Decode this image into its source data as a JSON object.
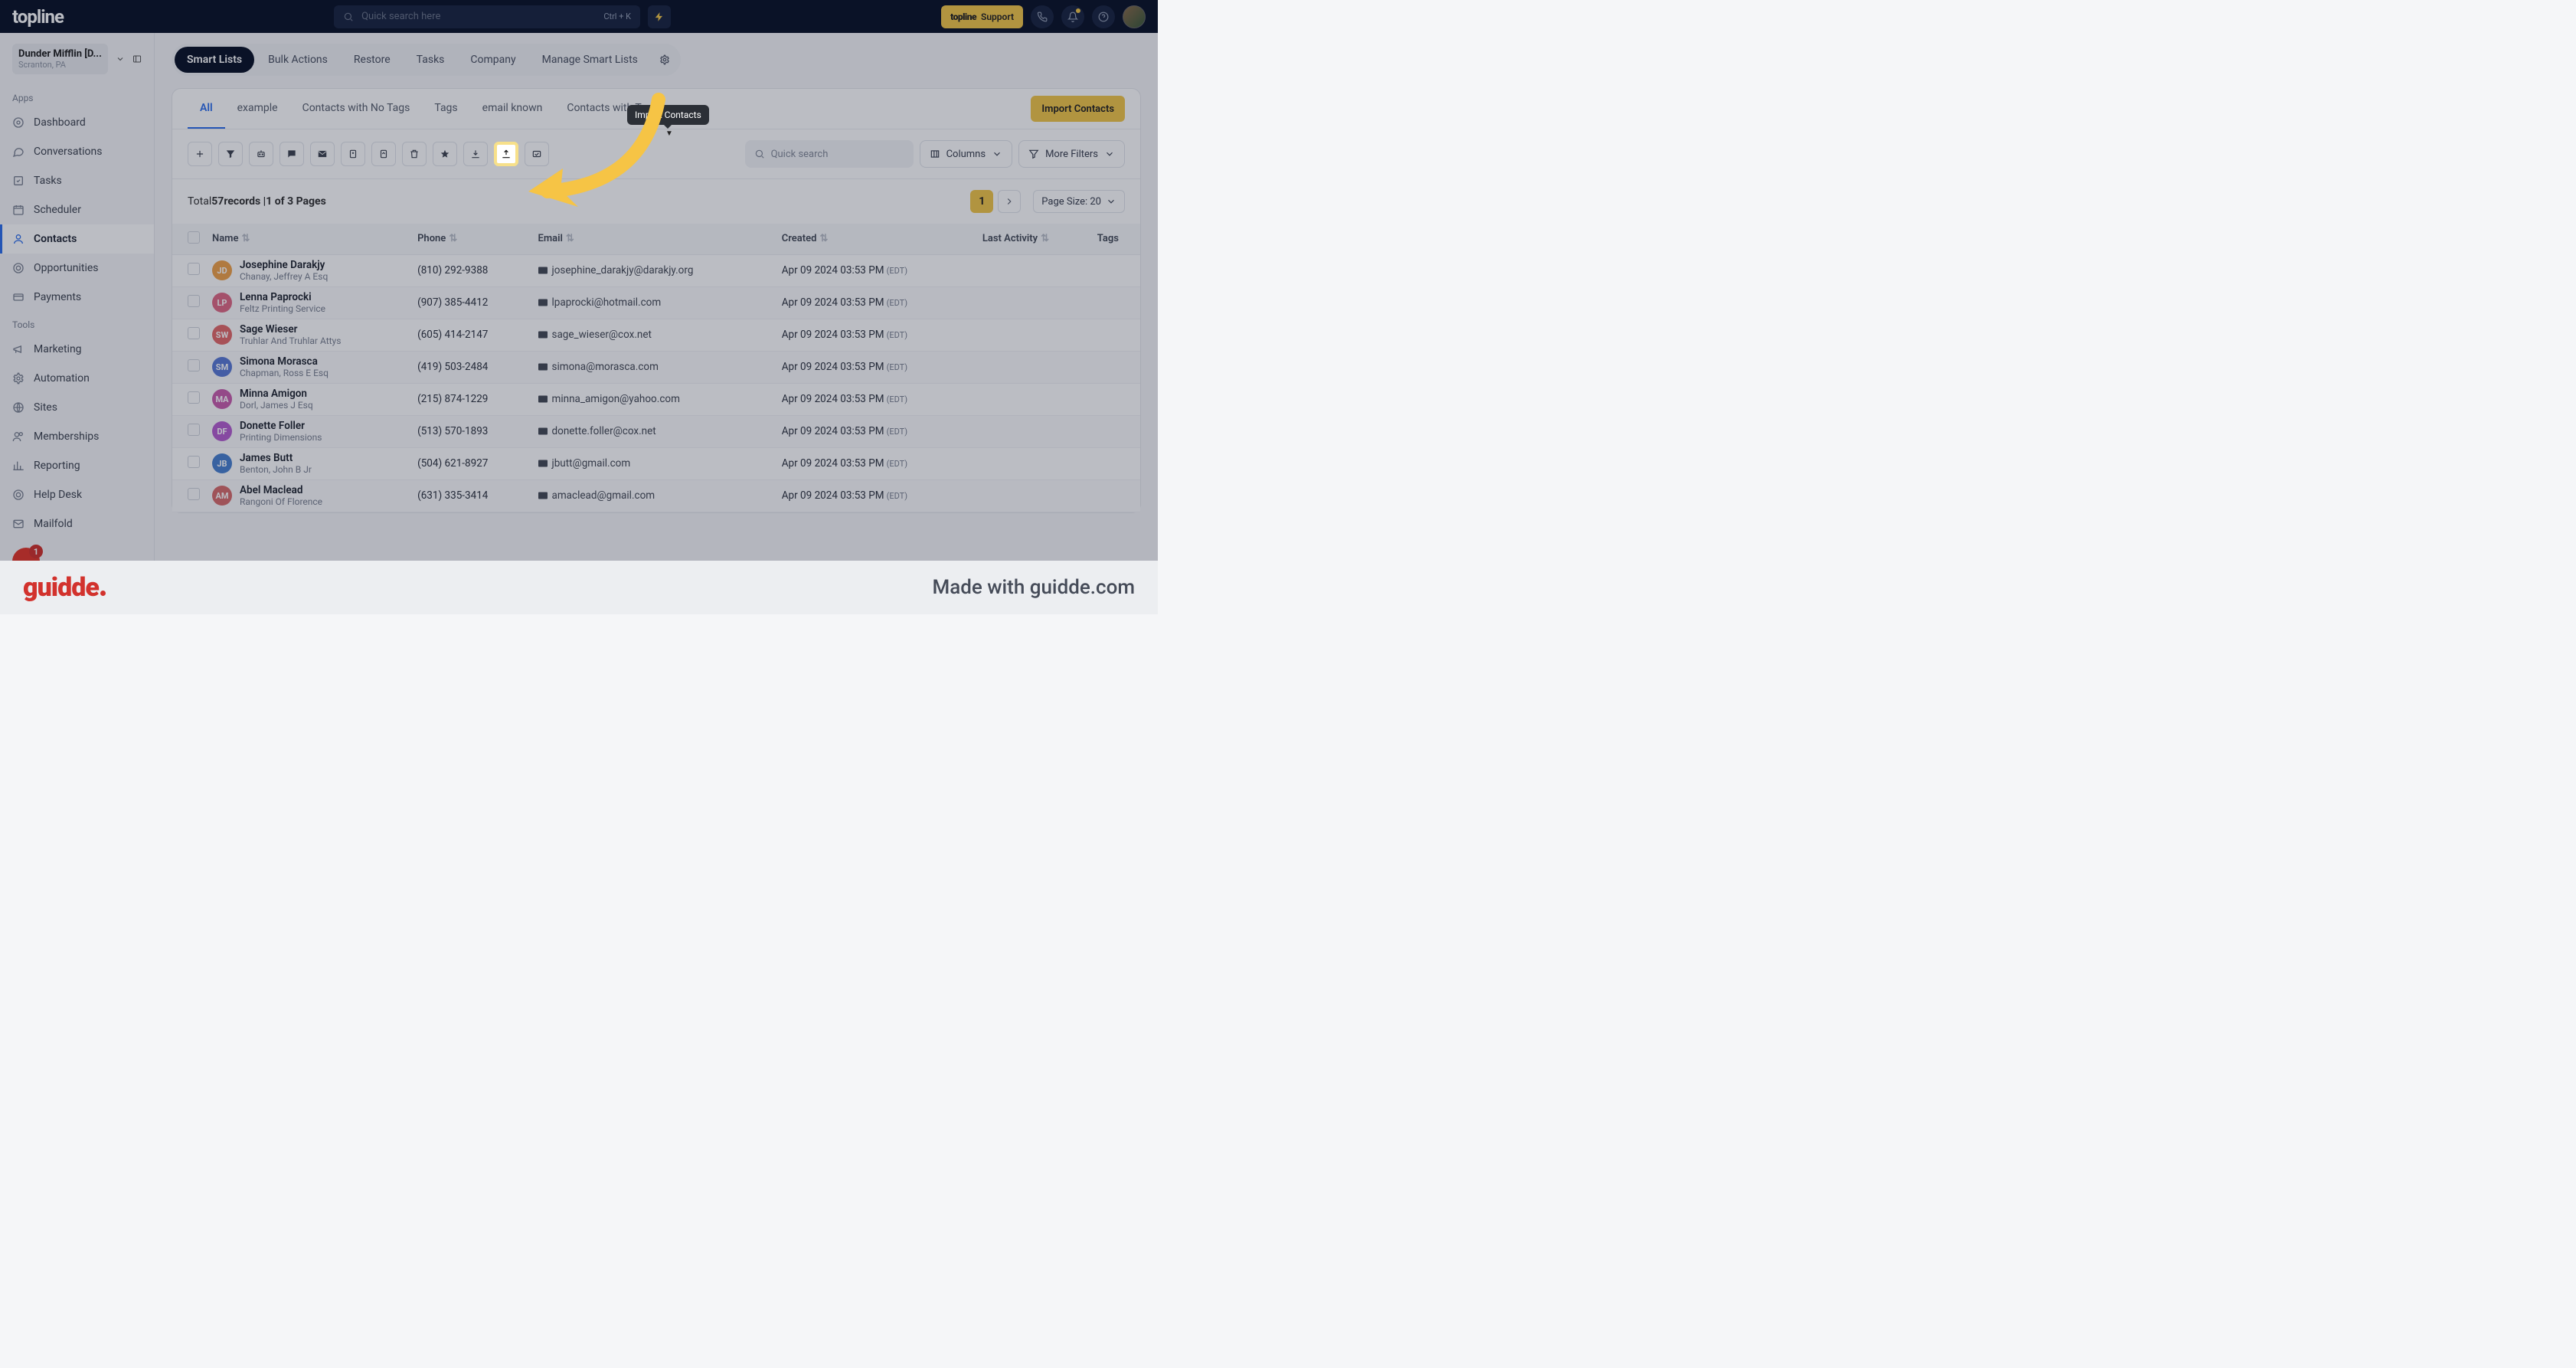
{
  "brand": "topline",
  "search_placeholder": "Quick search here",
  "search_hint": "Ctrl + K",
  "support_label": "Support",
  "support_brand": "topline",
  "tenant": {
    "name": "Dunder Mifflin [D...",
    "sub": "Scranton, PA"
  },
  "side_sections": {
    "apps": "Apps",
    "tools": "Tools"
  },
  "nav_apps": [
    {
      "label": "Dashboard"
    },
    {
      "label": "Conversations"
    },
    {
      "label": "Tasks"
    },
    {
      "label": "Scheduler"
    },
    {
      "label": "Contacts"
    },
    {
      "label": "Opportunities"
    },
    {
      "label": "Payments"
    }
  ],
  "nav_tools": [
    {
      "label": "Marketing"
    },
    {
      "label": "Automation"
    },
    {
      "label": "Sites"
    },
    {
      "label": "Memberships"
    },
    {
      "label": "Reporting"
    },
    {
      "label": "Help Desk"
    },
    {
      "label": "Mailfold"
    }
  ],
  "app_badge": "1",
  "topnav": {
    "items": [
      "Smart Lists",
      "Bulk Actions",
      "Restore",
      "Tasks",
      "Company",
      "Manage Smart Lists"
    ],
    "active": 0
  },
  "tabs": [
    "All",
    "example",
    "Contacts with No Tags",
    "Tags",
    "email known",
    "Contacts with Tags"
  ],
  "tabs_active": 0,
  "import_btn": "Import Contacts",
  "tooltip": "Import Contacts",
  "quick_search": "Quick search",
  "columns_btn": "Columns",
  "filters_btn": "More Filters",
  "records_prefix": "Total ",
  "records_count": "57",
  "records_mid": " records | ",
  "records_pages": "1 of 3 Pages",
  "page_cur": "1",
  "page_size_label": "Page Size: 20",
  "headers": [
    "",
    "Name",
    "Phone",
    "Email",
    "Created",
    "Last Activity",
    "Tags"
  ],
  "rows": [
    {
      "ini": "JD",
      "c": "#f0a24a",
      "name": "Josephine Darakjy",
      "sub": "Chanay, Jeffrey A Esq",
      "phone": "(810) 292-9388",
      "email": "josephine_darakjy@darakjy.org",
      "created": "Apr 09 2024 03:53 PM",
      "tz": "(EDT)"
    },
    {
      "ini": "LP",
      "c": "#e06a86",
      "name": "Lenna Paprocki",
      "sub": "Feltz Printing Service",
      "phone": "(907) 385-4412",
      "email": "lpaprocki@hotmail.com",
      "created": "Apr 09 2024 03:53 PM",
      "tz": "(EDT)"
    },
    {
      "ini": "SW",
      "c": "#e36a6a",
      "name": "Sage Wieser",
      "sub": "Truhlar And Truhlar Attys",
      "phone": "(605) 414-2147",
      "email": "sage_wieser@cox.net",
      "created": "Apr 09 2024 03:53 PM",
      "tz": "(EDT)"
    },
    {
      "ini": "SM",
      "c": "#5a7ad6",
      "name": "Simona Morasca",
      "sub": "Chapman, Ross E Esq",
      "phone": "(419) 503-2484",
      "email": "simona@morasca.com",
      "created": "Apr 09 2024 03:53 PM",
      "tz": "(EDT)"
    },
    {
      "ini": "MA",
      "c": "#c95fae",
      "name": "Minna Amigon",
      "sub": "Dorl, James J Esq",
      "phone": "(215) 874-1229",
      "email": "minna_amigon@yahoo.com",
      "created": "Apr 09 2024 03:53 PM",
      "tz": "(EDT)"
    },
    {
      "ini": "DF",
      "c": "#b65fd0",
      "name": "Donette Foller",
      "sub": "Printing Dimensions",
      "phone": "(513) 570-1893",
      "email": "donette.foller@cox.net",
      "created": "Apr 09 2024 03:53 PM",
      "tz": "(EDT)"
    },
    {
      "ini": "JB",
      "c": "#4a82d0",
      "name": "James Butt",
      "sub": "Benton, John B Jr",
      "phone": "(504) 621-8927",
      "email": "jbutt@gmail.com",
      "created": "Apr 09 2024 03:53 PM",
      "tz": "(EDT)"
    },
    {
      "ini": "AM",
      "c": "#d96d6d",
      "name": "Abel Maclead",
      "sub": "Rangoni Of Florence",
      "phone": "(631) 335-3414",
      "email": "amaclead@gmail.com",
      "created": "Apr 09 2024 03:53 PM",
      "tz": "(EDT)"
    }
  ],
  "footer": {
    "brand": "guidde",
    "made": "Made with guidde.com"
  }
}
